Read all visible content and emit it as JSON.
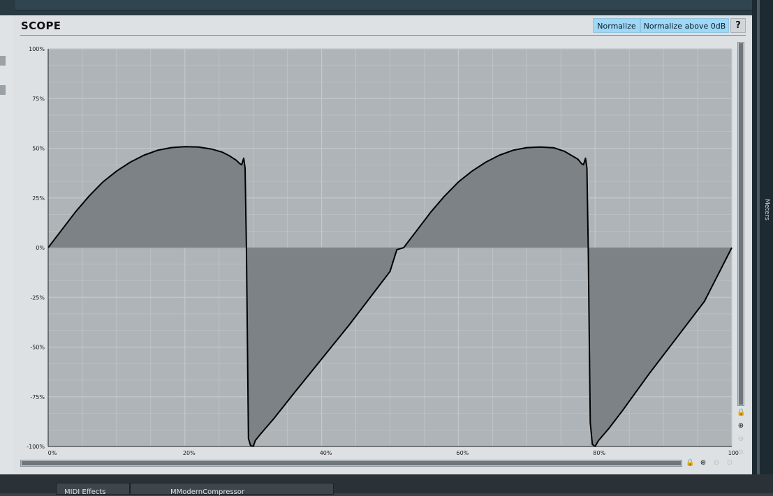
{
  "scope": {
    "title": "SCOPE",
    "buttons": {
      "normalize": "Normalize",
      "normalize_above": "Normalize above 0dB",
      "help": "?"
    }
  },
  "host": {
    "meters_label": "Meters",
    "bottom_tab_1": "MIDI Effects",
    "bottom_tab_2": "MModernCompressor"
  },
  "icons": {
    "lock": "lock-icon",
    "zoom_in": "zoom-in-icon",
    "zoom_out": "zoom-out-icon",
    "zoom_reset": "zoom-reset-icon"
  },
  "chart_data": {
    "type": "line",
    "fill": "area-to-zero",
    "x_ticks": [
      "0%",
      "20%",
      "40%",
      "60%",
      "80%",
      "100%"
    ],
    "y_ticks": [
      "100%",
      "75%",
      "50%",
      "25%",
      "0%",
      "-25%",
      "-50%",
      "-75%",
      "-100%"
    ],
    "xlim": [
      0,
      100
    ],
    "ylim": [
      -100,
      100
    ],
    "grid": true,
    "colors": {
      "plot_bg": "#aeb4b8",
      "fill": "#7d8286",
      "line": "#000000",
      "grid": "#c3c8cb"
    },
    "points": [
      [
        0,
        0
      ],
      [
        2,
        9
      ],
      [
        4,
        18
      ],
      [
        6,
        26
      ],
      [
        8,
        33
      ],
      [
        10,
        38.5
      ],
      [
        12,
        43
      ],
      [
        14,
        46.5
      ],
      [
        16,
        49
      ],
      [
        18,
        50.3
      ],
      [
        20,
        50.8
      ],
      [
        22,
        50.6
      ],
      [
        24,
        49.5
      ],
      [
        25.5,
        48
      ],
      [
        26.5,
        46.2
      ],
      [
        27.5,
        44
      ],
      [
        28,
        42.3
      ],
      [
        28.3,
        41.7
      ],
      [
        28.6,
        45
      ],
      [
        28.8,
        40
      ],
      [
        29,
        0
      ],
      [
        29.3,
        -96
      ],
      [
        29.6,
        -99.5
      ],
      [
        30,
        -100
      ],
      [
        30.3,
        -97
      ],
      [
        31,
        -94
      ],
      [
        33,
        -86
      ],
      [
        36,
        -73
      ],
      [
        40,
        -56
      ],
      [
        44,
        -39
      ],
      [
        48,
        -21
      ],
      [
        50,
        -12
      ],
      [
        51,
        -1
      ],
      [
        52,
        0
      ],
      [
        52,
        0
      ],
      [
        54,
        9
      ],
      [
        56,
        18
      ],
      [
        58,
        26
      ],
      [
        60,
        33
      ],
      [
        62,
        38.5
      ],
      [
        64,
        43
      ],
      [
        66,
        46.5
      ],
      [
        68,
        49
      ],
      [
        70,
        50.3
      ],
      [
        72,
        50.6
      ],
      [
        74,
        50.2
      ],
      [
        75.5,
        48.5
      ],
      [
        76.5,
        46.5
      ],
      [
        77.5,
        44.5
      ],
      [
        78,
        42.3
      ],
      [
        78.3,
        41.7
      ],
      [
        78.6,
        45
      ],
      [
        78.8,
        40
      ],
      [
        79,
        0
      ],
      [
        79.3,
        -88
      ],
      [
        79.6,
        -99
      ],
      [
        80,
        -100
      ],
      [
        80.5,
        -97
      ],
      [
        82,
        -91
      ],
      [
        84,
        -82
      ],
      [
        88,
        -63
      ],
      [
        92,
        -45
      ],
      [
        96,
        -27
      ],
      [
        100,
        0
      ]
    ]
  }
}
